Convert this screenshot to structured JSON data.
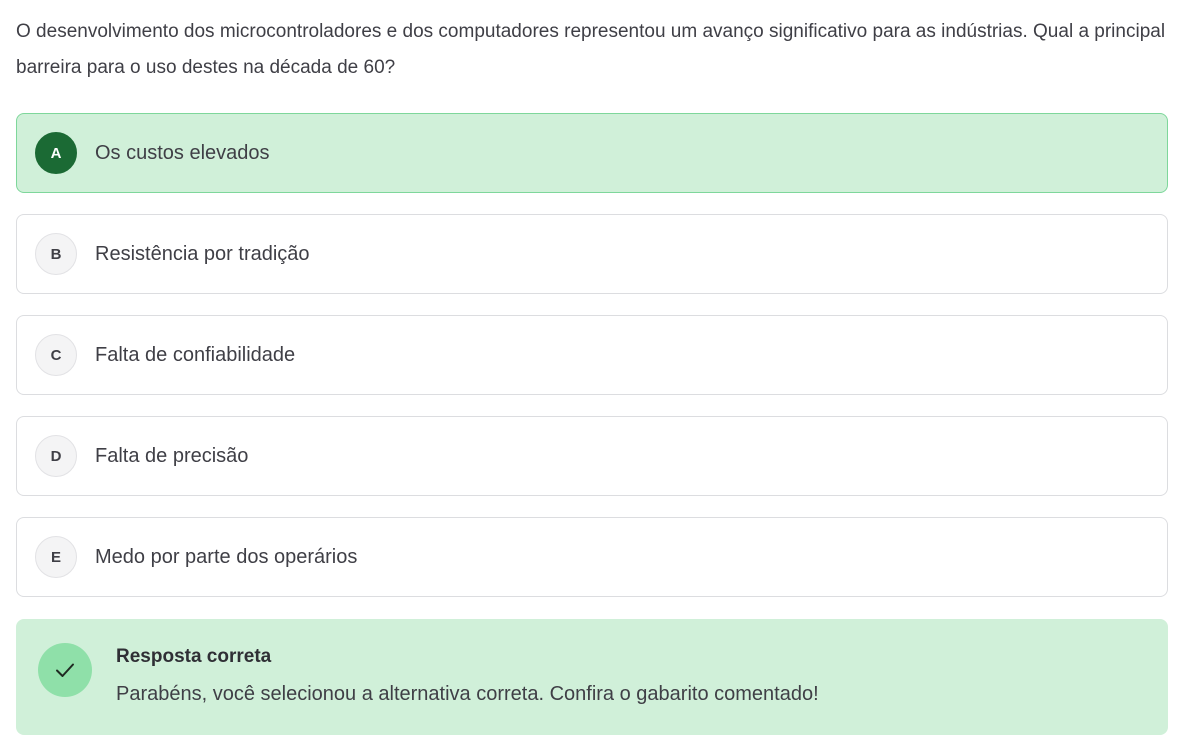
{
  "question": {
    "text": "O desenvolvimento dos microcontroladores e dos computadores representou um avanço significativo para as indústrias. Qual a principal barreira para o uso destes na década de 60?"
  },
  "options": [
    {
      "letter": "A",
      "text": "Os custos elevados",
      "selected": true
    },
    {
      "letter": "B",
      "text": "Resistência por tradição",
      "selected": false
    },
    {
      "letter": "C",
      "text": "Falta de confiabilidade",
      "selected": false
    },
    {
      "letter": "D",
      "text": "Falta de precisão",
      "selected": false
    },
    {
      "letter": "E",
      "text": "Medo por parte dos operários",
      "selected": false
    }
  ],
  "feedback": {
    "icon": "check-icon",
    "title": "Resposta correta",
    "message": "Parabéns, você selecionou a alternativa correta. Confira o gabarito comentado!"
  },
  "colors": {
    "selected_background": "#d0f0d9",
    "selected_border": "#7ed79b",
    "selected_badge": "#1b6a34",
    "check_circle": "#8fe0a9"
  }
}
